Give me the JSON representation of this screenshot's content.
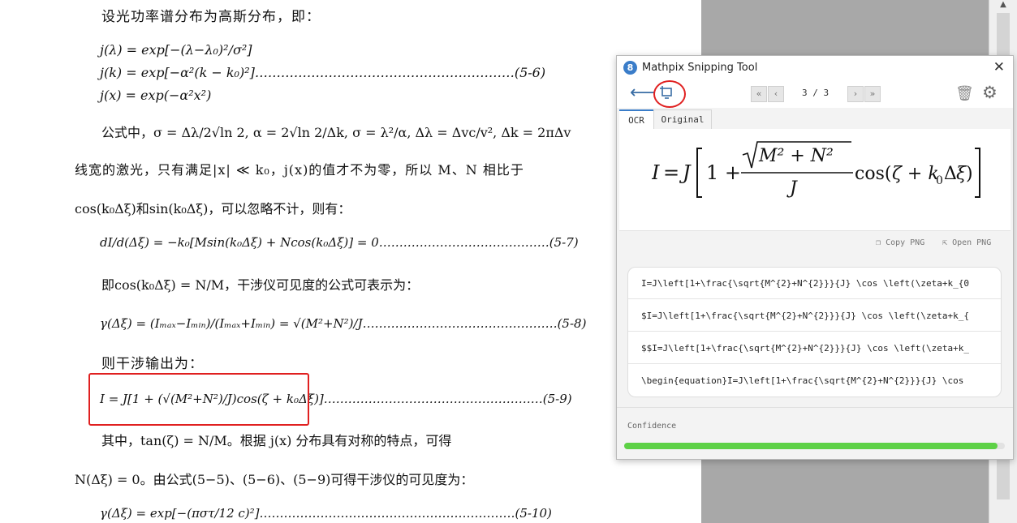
{
  "document": {
    "line1": "设光功率谱分布为高斯分布，即：",
    "eq56_a": "j(λ)      = exp[−(λ−λ₀)²/σ²]",
    "eq56_b": "j(k)   = exp[−α²(k − k₀)²]……………………………………………………(5-6)",
    "eq56_c": "j(x)      = exp(−α²x²)",
    "para1": "公式中，σ = Δλ/2√ln 2, α = 2√ln 2/Δk, σ = λ²/α, Δλ = Δvc/v², Δk = 2πΔv",
    "para2": "线宽的激光，只有满足|x| ≪ k₀，j(x)的值才不为零，所以 M、N 相比于",
    "para3": "cos(k₀Δξ)和sin(k₀Δξ)，可以忽略不计，则有：",
    "eq57": "dI/d(Δξ) = −k₀[Msin(k₀Δξ) + Ncos(k₀Δξ)] = 0……………………………………(5-7)",
    "para4": "即cos(k₀Δξ) = N/M，干涉仪可见度的公式可表示为：",
    "eq58": "γ(Δξ) = (Iₘₐₓ−Iₘᵢₙ)/(Iₘₐₓ+Iₘᵢₙ) = √(M²+N²)/J…………………………………………(5-8)",
    "para5": "则干涉输出为：",
    "eq59": "I = J[1 + (√(M²+N²)/J)cos(ζ + k₀Δξ)]………………………………………………(5-9)",
    "para6": "其中，tan(ζ) = N/M。根据  j(x)  分布具有对称的特点，可得",
    "para7": "N(Δξ) = 0。由公式(5−5)、(5−6)、(5−9)可得干涉仪的可见度为：",
    "eq510": "γ(Δξ) = exp[−(πστ/12 c)²]………………………………………………………(5-10)"
  },
  "mathpix": {
    "title": "Mathpix Snipping Tool",
    "logo": "8",
    "page_indicator": "3 / 3",
    "tabs": {
      "ocr": "OCR",
      "original": "Original"
    },
    "formula": "I = J[1 + √(M² + N²)/J cos(ζ + k₀Δξ)]",
    "copy_png": "Copy PNG",
    "open_png": "Open PNG",
    "latex_rows": [
      "I=J\\left[1+\\frac{\\sqrt{M^{2}+N^{2}}}{J} \\cos \\left(\\zeta+k_{0",
      "$I=J\\left[1+\\frac{\\sqrt{M^{2}+N^{2}}}{J} \\cos \\left(\\zeta+k_{",
      "$$I=J\\left[1+\\frac{\\sqrt{M^{2}+N^{2}}}{J} \\cos \\left(\\zeta+k_",
      "\\begin{equation}I=J\\left[1+\\frac{\\sqrt{M^{2}+N^{2}}}{J} \\cos"
    ],
    "confidence_label": "Confidence",
    "confidence": 0.98,
    "colors": {
      "accent": "#3a7dc9",
      "confidence": "#5dd146",
      "highlight": "#e02020"
    }
  }
}
